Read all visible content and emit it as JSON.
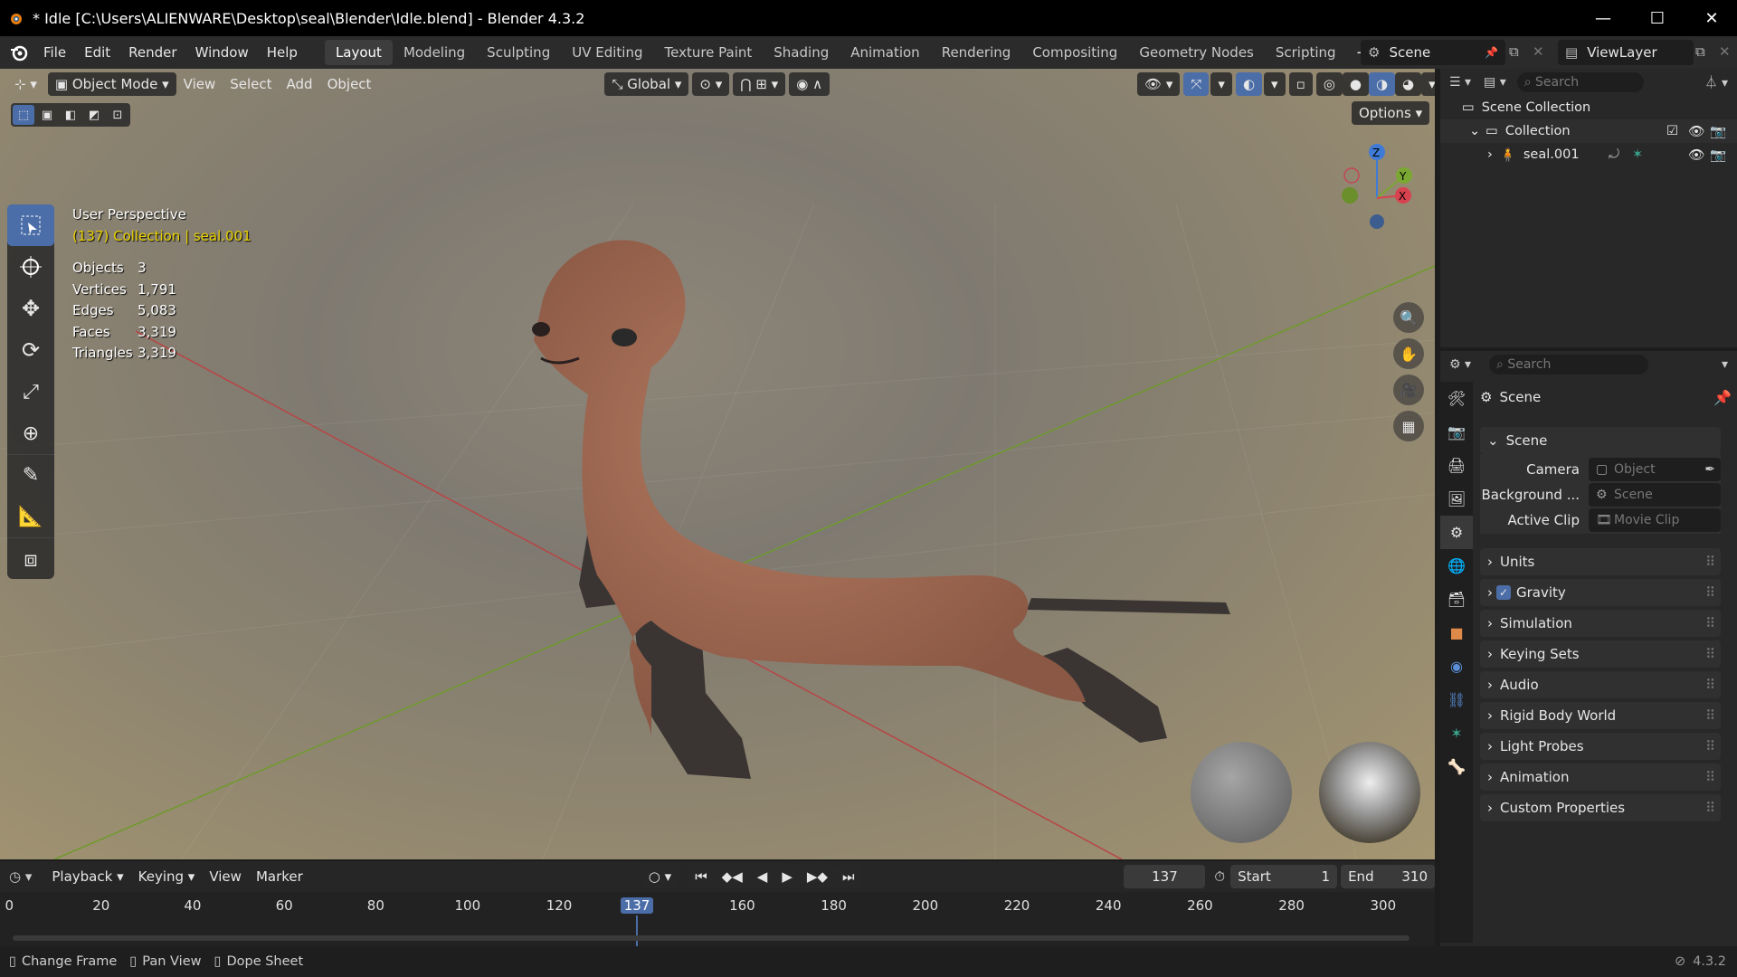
{
  "window": {
    "title": "* Idle [C:\\Users\\ALIENWARE\\Desktop\\seal\\Blender\\Idle.blend] - Blender 4.3.2"
  },
  "menu": {
    "items": [
      "File",
      "Edit",
      "Render",
      "Window",
      "Help"
    ]
  },
  "workspaces": [
    "Layout",
    "Modeling",
    "Sculpting",
    "UV Editing",
    "Texture Paint",
    "Shading",
    "Animation",
    "Rendering",
    "Compositing",
    "Geometry Nodes",
    "Scripting"
  ],
  "active_workspace": "Layout",
  "scene_selector": {
    "scene": "Scene",
    "view_layer": "ViewLayer"
  },
  "viewport": {
    "mode": "Object Mode",
    "menus": [
      "View",
      "Select",
      "Add",
      "Object"
    ],
    "transform_orientation": "Global",
    "options_label": "Options",
    "perspective_label": "User Perspective",
    "context_label": "(137) Collection | seal.001",
    "stats": [
      {
        "key": "Objects",
        "value": "3"
      },
      {
        "key": "Vertices",
        "value": "1,791"
      },
      {
        "key": "Edges",
        "value": "5,083"
      },
      {
        "key": "Faces",
        "value": "3,319"
      },
      {
        "key": "Triangles",
        "value": "3,319"
      }
    ],
    "gizmo_axes": {
      "z": "Z",
      "y": "Y",
      "x": "X"
    }
  },
  "outliner": {
    "search_placeholder": "Search",
    "root": "Scene Collection",
    "collection": "Collection",
    "object": "seal.001"
  },
  "properties": {
    "search_placeholder": "Search",
    "context_title": "Scene",
    "panel_title": "Scene",
    "fields": [
      {
        "label": "Camera",
        "placeholder": "Object"
      },
      {
        "label": "Background ...",
        "placeholder": "Scene"
      },
      {
        "label": "Active Clip",
        "placeholder": "Movie Clip"
      }
    ],
    "sections": [
      "Units",
      "Gravity",
      "Simulation",
      "Keying Sets",
      "Audio",
      "Rigid Body World",
      "Light Probes",
      "Animation",
      "Custom Properties"
    ],
    "gravity_checked": true
  },
  "timeline": {
    "menus": [
      "Playback",
      "Keying",
      "View",
      "Marker"
    ],
    "current_frame": "137",
    "start_label": "Start",
    "start": "1",
    "end_label": "End",
    "end": "310",
    "ticks": [
      "0",
      "20",
      "40",
      "60",
      "80",
      "100",
      "120",
      "137",
      "160",
      "180",
      "200",
      "220",
      "240",
      "260",
      "280",
      "300"
    ]
  },
  "statusbar": {
    "hints": [
      "Change Frame",
      "Pan View",
      "Dope Sheet"
    ],
    "version": "4.3.2"
  },
  "colors": {
    "accent": "#4b6da8",
    "selection_text": "#e9d200",
    "seal_body": "#a8705a",
    "seal_flipper": "#3a3533"
  }
}
